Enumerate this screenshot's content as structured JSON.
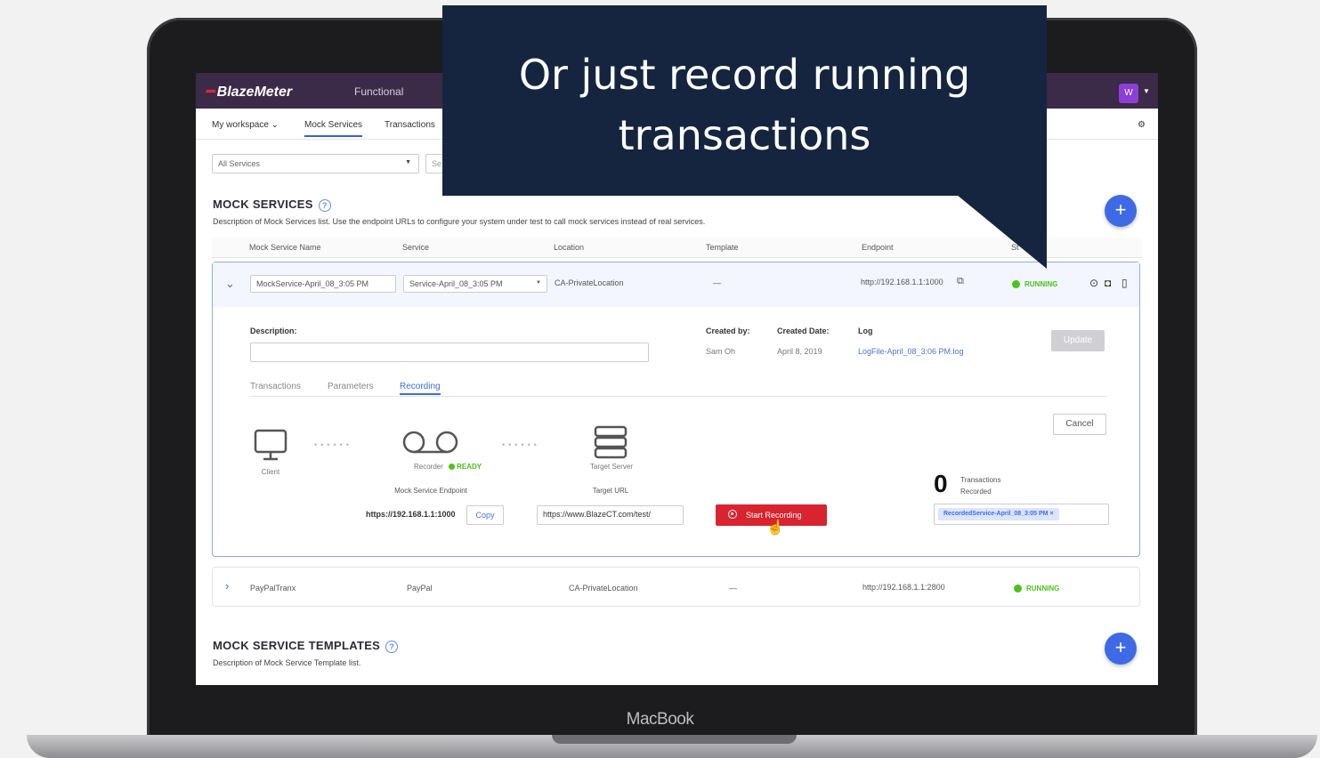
{
  "device": {
    "label": "MacBook"
  },
  "callout": {
    "line1": "Or just record running",
    "line2": "transactions"
  },
  "app": {
    "logo": "BlazeMeter",
    "nav_item": "Functional",
    "avatar": "W"
  },
  "subnav": {
    "workspace": "My workspace ⌄",
    "mock_services": "Mock Services",
    "transactions": "Transactions"
  },
  "filter": {
    "services": "All Services",
    "search": "Se"
  },
  "mock_services": {
    "title": "MOCK SERVICES",
    "description": "Description of Mock Services list. Use the endpoint URLs to configure your system under test to call mock services instead of real services.",
    "columns": [
      "Mock Service Name",
      "Service",
      "Location",
      "Template",
      "Endpoint",
      "St"
    ]
  },
  "row1": {
    "name": "MockService-April_08_3:05 PM",
    "service": "Service-April_08_3:05 PM",
    "location": "CA-PrivateLocation",
    "template": "—",
    "endpoint": "http://192.168.1.1:1000",
    "status": "RUNNING",
    "description_label": "Description:",
    "created_by_label": "Created by:",
    "created_by": "Sam Oh",
    "created_date_label": "Created Date:",
    "created_date": "April 8, 2019",
    "log_label": "Log",
    "log_file": "LogFile-April_08_3:06 PM.log",
    "update": "Update",
    "cancel": "Cancel",
    "tabs": [
      "Transactions",
      "Parameters",
      "Recording"
    ],
    "client": "Client",
    "recorder": "Recorder",
    "recorder_status": "READY",
    "target_server": "Target Server",
    "endpoint_label": "Mock Service Endpoint",
    "endpoint_value": "https://192.168.1.1:1000",
    "copy": "Copy",
    "target_url_label": "Target URL",
    "target_url": "https://www.BlazeCT.com/test/",
    "start_recording": "Start Recording",
    "transactions_count": "0",
    "transactions_label_1": "Transactions",
    "transactions_label_2": "Recorded",
    "recorded_chip": "RecordedService-April_08_3:05 PM  ×"
  },
  "row2": {
    "name": "PayPalTranx",
    "service": "PayPal",
    "location": "CA-PrivateLocation",
    "template": "—",
    "endpoint": "http://192.168.1.1:2800",
    "status": "RUNNING"
  },
  "templates": {
    "title": "MOCK SERVICE TEMPLATES",
    "description": "Description of Mock Service Template list."
  },
  "colors": {
    "callout_bg": "#15253f",
    "accent": "#3e6ae6",
    "record": "#d9232e",
    "running": "#4cc21a"
  }
}
